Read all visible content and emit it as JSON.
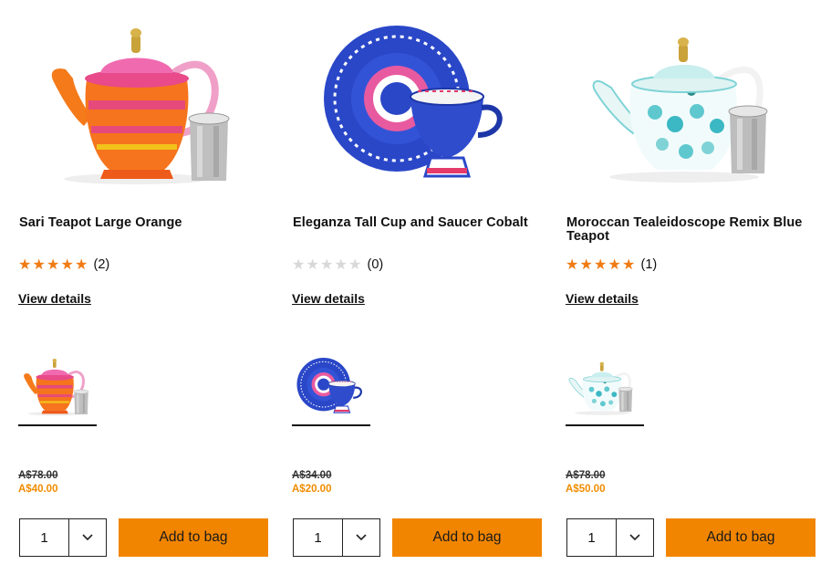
{
  "products": [
    {
      "title": "Sari Teapot Large Orange",
      "rating_stars": 5,
      "review_count": "(2)",
      "view_details": "View details",
      "was_price": "A$78.00",
      "now_price": "A$40.00",
      "quantity": "1",
      "add_to_bag": "Add to bag",
      "image_icon": "orange-teapot-image"
    },
    {
      "title": "Eleganza Tall Cup and Saucer Cobalt",
      "rating_stars": 0,
      "review_count": "(0)",
      "view_details": "View details",
      "was_price": "A$34.00",
      "now_price": "A$20.00",
      "quantity": "1",
      "add_to_bag": "Add to bag",
      "image_icon": "blue-cup-saucer-image"
    },
    {
      "title": "Moroccan Tealeidoscope Remix Blue Teapot",
      "rating_stars": 5,
      "review_count": "(1)",
      "view_details": "View details",
      "was_price": "A$78.00",
      "now_price": "A$50.00",
      "quantity": "1",
      "add_to_bag": "Add to bag",
      "image_icon": "turquoise-teapot-image"
    }
  ],
  "colors": {
    "accent_orange": "#f28500",
    "sale_price": "#f08c00",
    "star_filled": "#f07b14",
    "star_empty": "#d8d8d8"
  }
}
